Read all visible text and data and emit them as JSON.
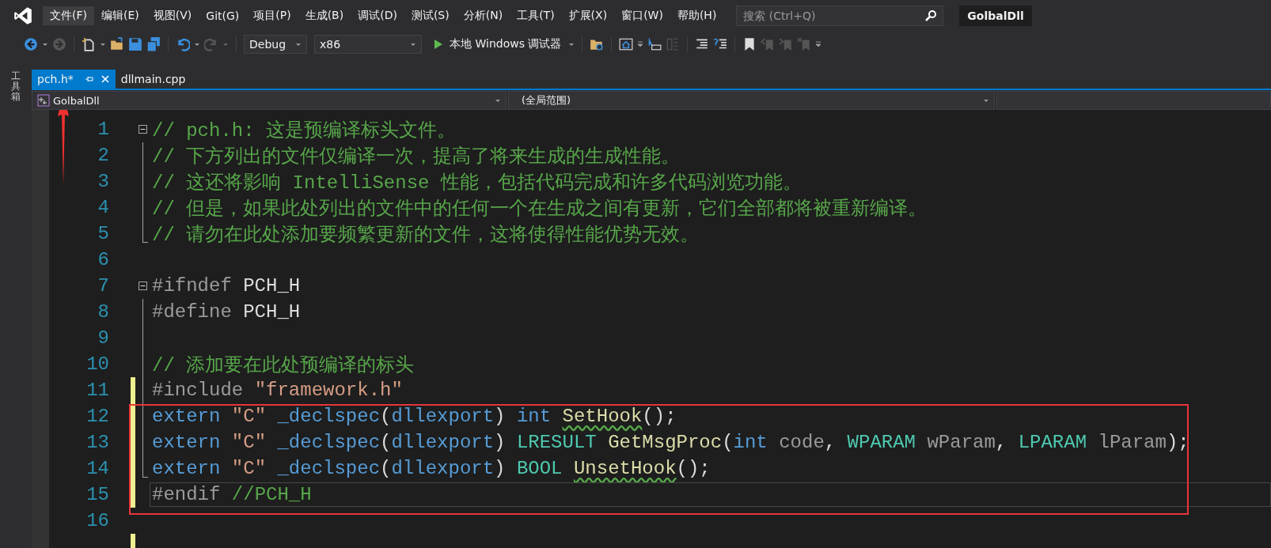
{
  "menu": [
    {
      "label": "文件(F)",
      "selected": true
    },
    {
      "label": "编辑(E)",
      "selected": false
    },
    {
      "label": "视图(V)",
      "selected": false
    },
    {
      "label": "Git(G)",
      "selected": false
    },
    {
      "label": "项目(P)",
      "selected": false
    },
    {
      "label": "生成(B)",
      "selected": false
    },
    {
      "label": "调试(D)",
      "selected": false
    },
    {
      "label": "测试(S)",
      "selected": false
    },
    {
      "label": "分析(N)",
      "selected": false
    },
    {
      "label": "工具(T)",
      "selected": false
    },
    {
      "label": "扩展(X)",
      "selected": false
    },
    {
      "label": "窗口(W)",
      "selected": false
    },
    {
      "label": "帮助(H)",
      "selected": false
    }
  ],
  "search": {
    "placeholder": "搜索 (Ctrl+Q)"
  },
  "solution_title": "GolbalDll",
  "toolbar": {
    "configuration": "Debug",
    "platform": "x86",
    "run_button": "本地 Windows 调试器"
  },
  "toolbox_tab": "工具箱",
  "tabs": [
    {
      "label": "pch.h*",
      "selected": true
    },
    {
      "label": "dllmain.cpp",
      "selected": false
    }
  ],
  "navigation": {
    "project": "GolbalDll",
    "scope": "(全局范围)"
  },
  "lines": [
    {
      "number": "1",
      "collapsible": true,
      "in_fold": false,
      "fold_end": false,
      "modified": false,
      "current": false,
      "tokens": [
        {
          "kind": "comment",
          "text": "// pch.h: 这是预编译标头文件。"
        }
      ]
    },
    {
      "number": "2",
      "collapsible": false,
      "in_fold": true,
      "fold_end": false,
      "modified": false,
      "current": false,
      "tokens": [
        {
          "kind": "comment",
          "text": "// 下方列出的文件仅编译一次，提高了将来生成的生成性能。"
        }
      ]
    },
    {
      "number": "3",
      "collapsible": false,
      "in_fold": true,
      "fold_end": false,
      "modified": false,
      "current": false,
      "tokens": [
        {
          "kind": "comment",
          "text": "// 这还将影响 IntelliSense 性能，包括代码完成和许多代码浏览功能。"
        }
      ]
    },
    {
      "number": "4",
      "collapsible": false,
      "in_fold": true,
      "fold_end": false,
      "modified": false,
      "current": false,
      "tokens": [
        {
          "kind": "comment",
          "text": "// 但是，如果此处列出的文件中的任何一个在生成之间有更新，它们全部都将被重新编译。"
        }
      ]
    },
    {
      "number": "5",
      "collapsible": false,
      "in_fold": false,
      "fold_end": true,
      "modified": false,
      "current": false,
      "tokens": [
        {
          "kind": "comment",
          "text": "// 请勿在此处添加要频繁更新的文件，这将使得性能优势无效。"
        }
      ]
    },
    {
      "number": "6",
      "collapsible": false,
      "in_fold": false,
      "fold_end": false,
      "modified": false,
      "current": false
    },
    {
      "number": "7",
      "collapsible": true,
      "in_fold": false,
      "fold_end": false,
      "modified": false,
      "current": false,
      "tokens": [
        {
          "kind": "pre",
          "text": "#ifndef "
        },
        {
          "kind": "macro",
          "text": "PCH_H"
        }
      ]
    },
    {
      "number": "8",
      "collapsible": false,
      "in_fold": true,
      "fold_end": false,
      "modified": false,
      "current": false,
      "tokens": [
        {
          "kind": "pre",
          "text": "#define "
        },
        {
          "kind": "macro",
          "text": "PCH_H"
        }
      ]
    },
    {
      "number": "9",
      "collapsible": false,
      "in_fold": true,
      "fold_end": false,
      "modified": false,
      "current": false
    },
    {
      "number": "10",
      "collapsible": false,
      "in_fold": true,
      "fold_end": false,
      "modified": false,
      "current": false,
      "tokens": [
        {
          "kind": "comment",
          "text": "// 添加要在此处预编译的标头"
        }
      ]
    },
    {
      "number": "11",
      "collapsible": false,
      "in_fold": true,
      "fold_end": false,
      "modified": true,
      "current": false,
      "tokens": [
        {
          "kind": "pre",
          "text": "#include "
        },
        {
          "kind": "string",
          "text": "\"framework.h\""
        }
      ]
    },
    {
      "number": "12",
      "collapsible": false,
      "in_fold": true,
      "fold_end": false,
      "modified": true,
      "current": false,
      "tokens": [
        {
          "kind": "keyword",
          "text": "extern "
        },
        {
          "kind": "string",
          "text": "\"C\" "
        },
        {
          "kind": "keyword",
          "text": "_declspec"
        },
        {
          "kind": "plain",
          "text": "("
        },
        {
          "kind": "keyword",
          "text": "dllexport"
        },
        {
          "kind": "plain",
          "text": ") "
        },
        {
          "kind": "keyword",
          "text": "int "
        },
        {
          "kind": "func",
          "text": "SetHook",
          "squiggle": true
        },
        {
          "kind": "plain",
          "text": "();"
        }
      ]
    },
    {
      "number": "13",
      "collapsible": false,
      "in_fold": true,
      "fold_end": false,
      "modified": true,
      "current": false,
      "tokens": [
        {
          "kind": "keyword",
          "text": "extern "
        },
        {
          "kind": "string",
          "text": "\"C\" "
        },
        {
          "kind": "keyword",
          "text": "_declspec"
        },
        {
          "kind": "plain",
          "text": "("
        },
        {
          "kind": "keyword",
          "text": "dllexport"
        },
        {
          "kind": "plain",
          "text": ") "
        },
        {
          "kind": "type",
          "text": "LRESULT "
        },
        {
          "kind": "func",
          "text": "GetMsgProc"
        },
        {
          "kind": "plain",
          "text": "("
        },
        {
          "kind": "keyword",
          "text": "int "
        },
        {
          "kind": "param",
          "text": "code"
        },
        {
          "kind": "plain",
          "text": ", "
        },
        {
          "kind": "type",
          "text": "WPARAM "
        },
        {
          "kind": "param",
          "text": "wParam"
        },
        {
          "kind": "plain",
          "text": ", "
        },
        {
          "kind": "type",
          "text": "LPARAM "
        },
        {
          "kind": "param",
          "text": "lParam"
        },
        {
          "kind": "plain",
          "text": ");"
        }
      ]
    },
    {
      "number": "14",
      "collapsible": false,
      "in_fold": false,
      "fold_end": true,
      "modified": true,
      "current": false,
      "tokens": [
        {
          "kind": "keyword",
          "text": "extern "
        },
        {
          "kind": "string",
          "text": "\"C\" "
        },
        {
          "kind": "keyword",
          "text": "_declspec"
        },
        {
          "kind": "plain",
          "text": "("
        },
        {
          "kind": "keyword",
          "text": "dllexport"
        },
        {
          "kind": "plain",
          "text": ") "
        },
        {
          "kind": "type",
          "text": "BOOL "
        },
        {
          "kind": "func",
          "text": "UnsetHook",
          "squiggle": true
        },
        {
          "kind": "plain",
          "text": "();"
        }
      ]
    },
    {
      "number": "15",
      "collapsible": false,
      "in_fold": false,
      "fold_end": false,
      "modified": true,
      "current": true,
      "tokens": [
        {
          "kind": "pre",
          "text": "#endif "
        },
        {
          "kind": "comment",
          "text": "//PCH_H"
        }
      ]
    },
    {
      "number": "16",
      "collapsible": false,
      "in_fold": false,
      "fold_end": false,
      "modified": false,
      "current": false
    },
    {
      "collapsible": false,
      "in_fold": false,
      "fold_end": false,
      "modified": true,
      "current": false
    }
  ],
  "annotations": {
    "arrow": true,
    "box": true
  }
}
